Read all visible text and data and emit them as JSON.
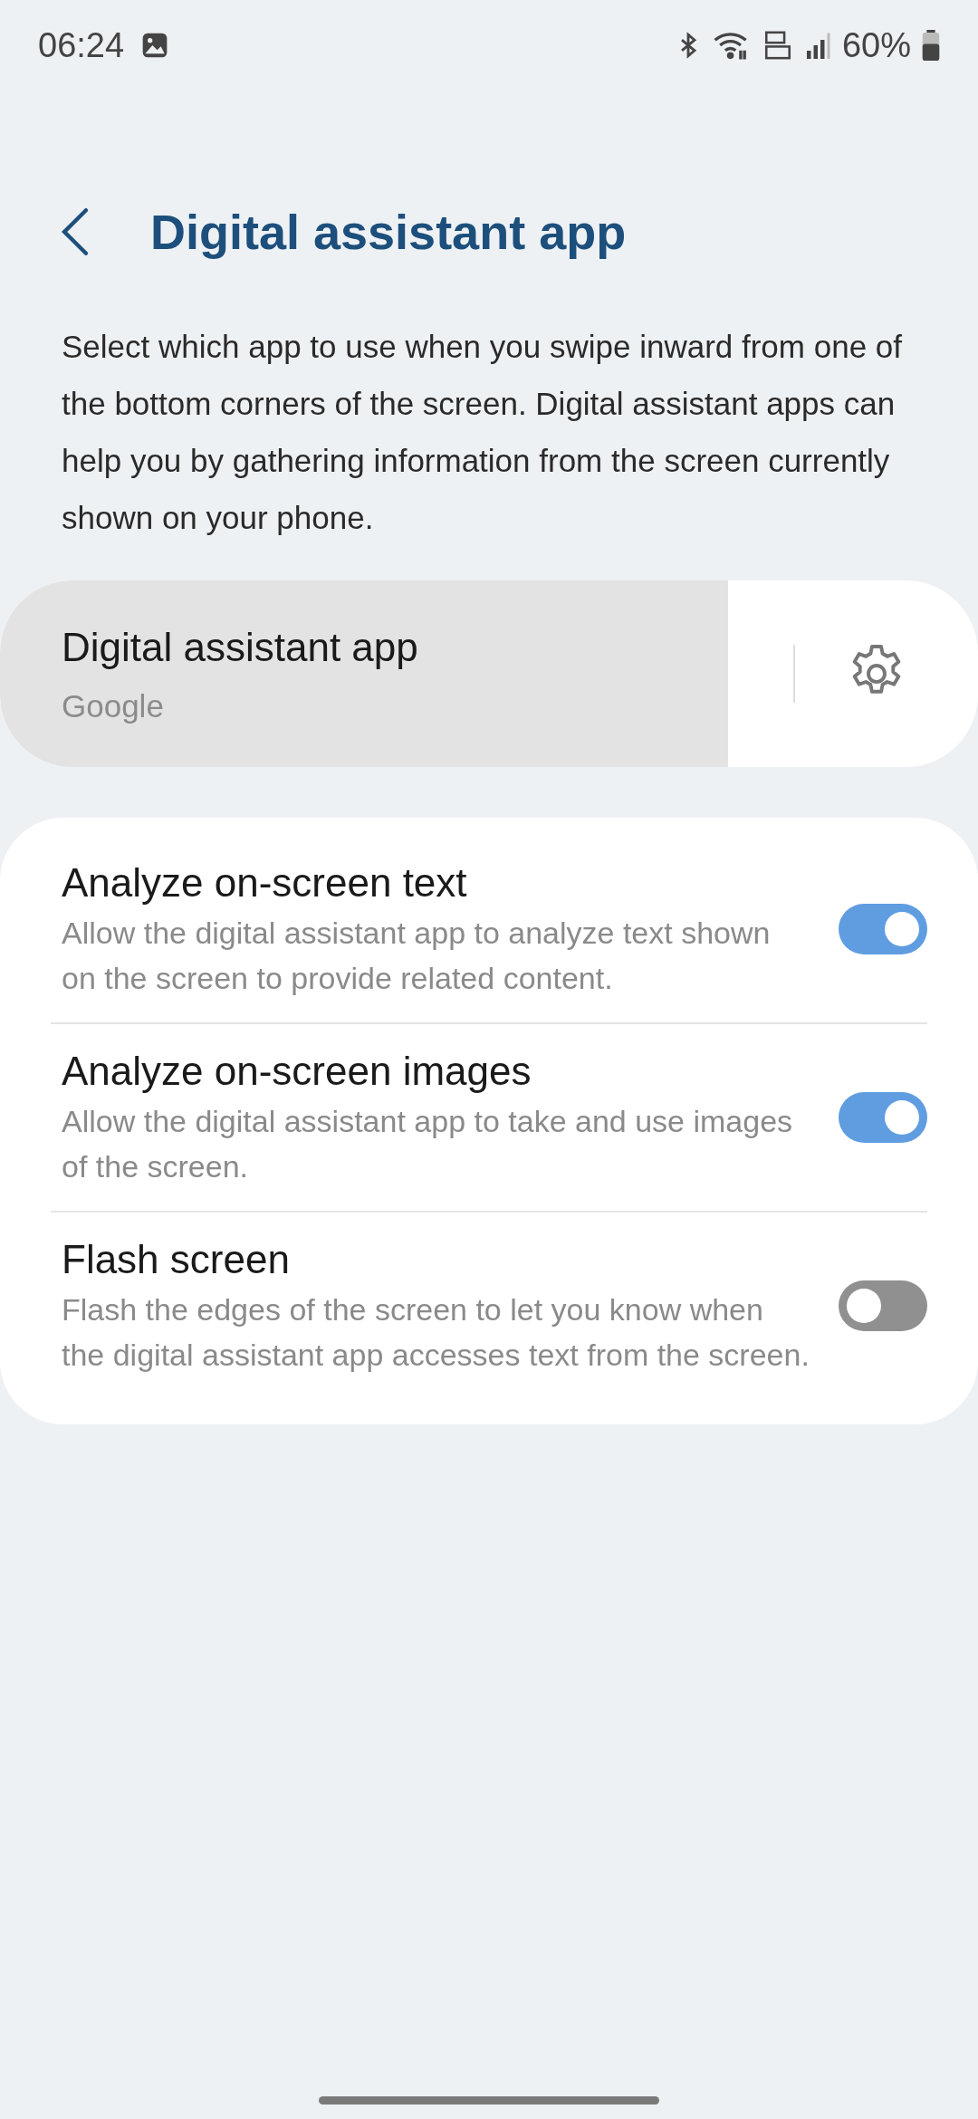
{
  "status_bar": {
    "time": "06:24",
    "battery": "60%"
  },
  "header": {
    "title": "Digital assistant app"
  },
  "description": "Select which app to use when you swipe inward from one of the bottom corners of the screen. Digital assistant apps can help you by gathering information from the screen currently shown on your phone.",
  "assistant": {
    "title": "Digital assistant app",
    "value": "Google",
    "pressed": true
  },
  "settings": [
    {
      "title": "Analyze on-screen text",
      "description": "Allow the digital assistant app to analyze text shown on the screen to provide related content.",
      "on": true
    },
    {
      "title": "Analyze on-screen images",
      "description": "Allow the digital assistant app to take and use images of the screen.",
      "on": true
    },
    {
      "title": "Flash screen",
      "description": "Flash the edges of the screen to let you know when the digital assistant app accesses text from the screen.",
      "on": false
    }
  ]
}
